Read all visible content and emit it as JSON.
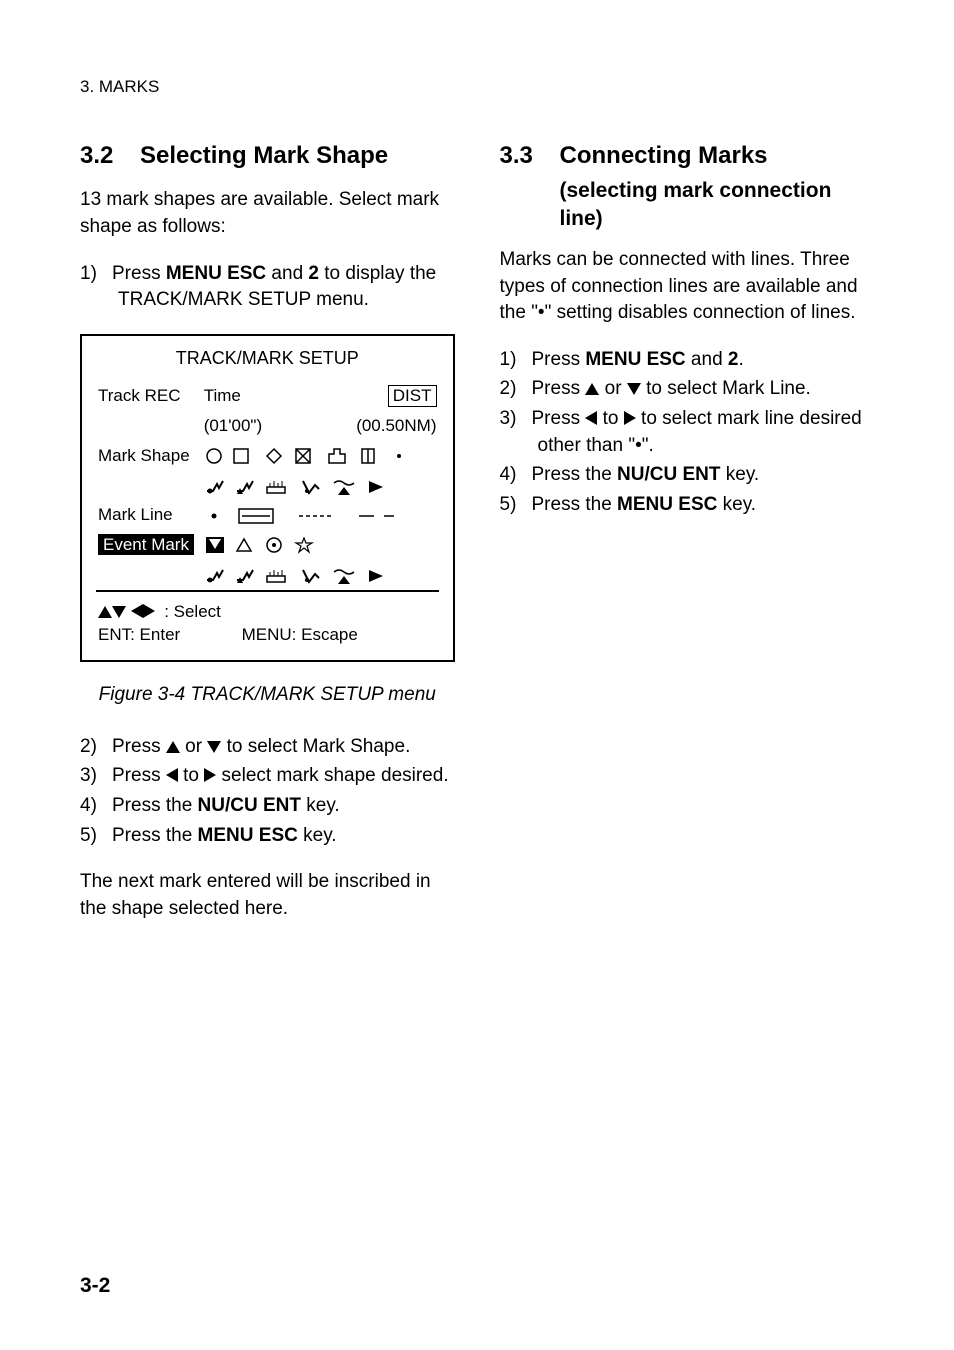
{
  "header": "3. MARKS",
  "left": {
    "sec_num": "3.2",
    "sec_title": "Selecting Mark Shape",
    "intro": "13 mark shapes are available. Select mark shape as follows:",
    "step1_pre": "Press ",
    "step1_b1": "MENU ESC",
    "step1_mid": " and ",
    "step1_b2": "2",
    "step1_post": " to display the TRACK/MARK SETUP menu.",
    "diagram": {
      "title": "TRACK/MARK SETUP",
      "track_rec": "Track REC",
      "time": "Time",
      "time_val": "(01'00\")",
      "dist": "DIST",
      "dist_val": "(00.50NM)",
      "mark_shape": "Mark Shape",
      "mark_line": "Mark Line",
      "event_mark": "Event Mark",
      "select": ": Select",
      "ent": "ENT: Enter",
      "menu_esc": "MENU: Escape"
    },
    "caption": "Figure 3-4 TRACK/MARK SETUP menu",
    "step2_a": "Press ",
    "step2_mid": " or ",
    "step2_b": " to select Mark Shape.",
    "step3_a": "Press ",
    "step3_mid": " to ",
    "step3_b": " select mark shape desired.",
    "step4_a": "Press the ",
    "step4_b": "NU/CU ENT",
    "step4_c": " key.",
    "step5_a": "Press the ",
    "step5_b": "MENU ESC",
    "step5_c": " key.",
    "outro": "The next mark entered will be inscribed in the shape selected here."
  },
  "right": {
    "sec_num": "3.3",
    "sec_title": "Connecting Marks",
    "sub": "(selecting mark connection line)",
    "intro": "Marks can be connected with lines. Three types of connection lines are available and the \"•\" setting disables connection of lines.",
    "step1_a": "Press ",
    "step1_b1": "MENU ESC",
    "step1_mid": " and ",
    "step1_b2": "2",
    "step1_c": ".",
    "step2_a": "Press ",
    "step2_mid": " or ",
    "step2_b": " to select Mark Line.",
    "step3_a": "Press ",
    "step3_mid": " to ",
    "step3_b": " to select mark line desired other than \"•\".",
    "step4_a": "Press the ",
    "step4_b": "NU/CU ENT",
    "step4_c": " key.",
    "step5_a": "Press the ",
    "step5_b": "MENU ESC",
    "step5_c": " key."
  },
  "footer": "3-2"
}
